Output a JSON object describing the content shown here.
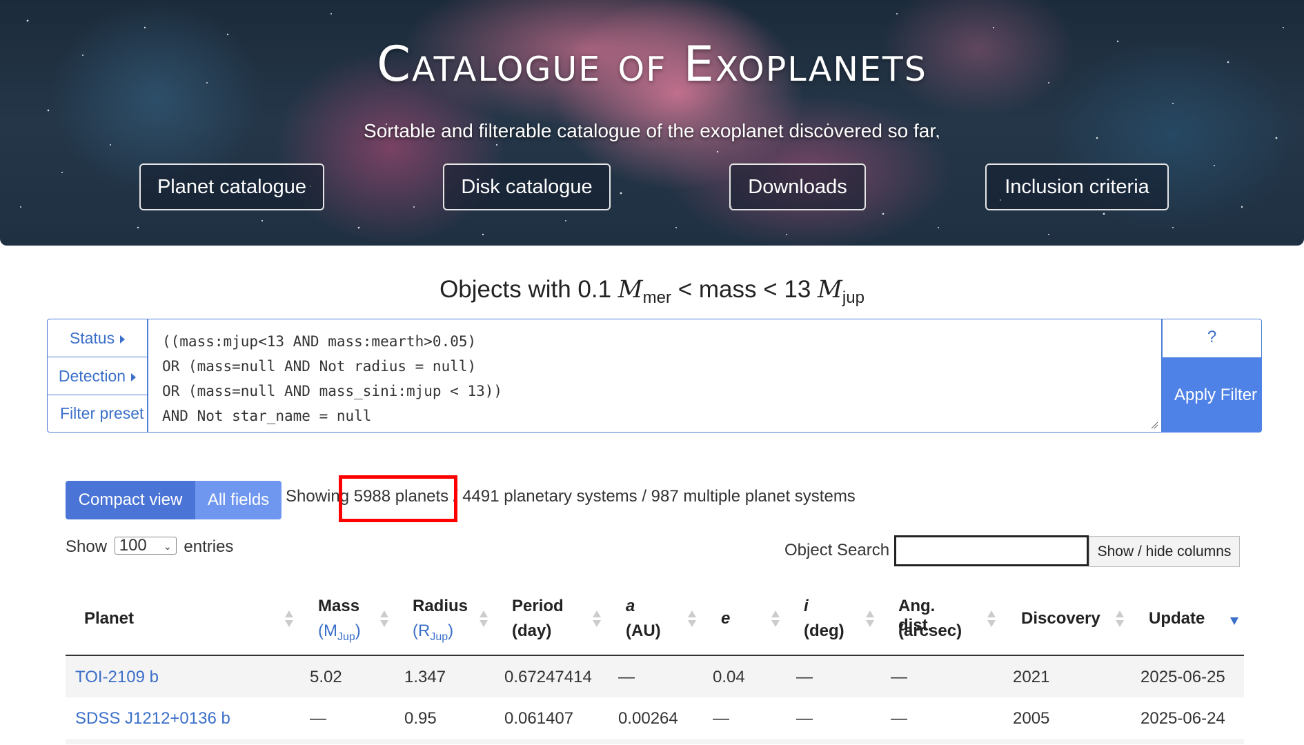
{
  "hero": {
    "title": "Catalogue of Exoplanets",
    "subtitle": "Sortable and filterable catalogue of the exoplanet discovered so far.",
    "nav": [
      "Planet catalogue",
      "Disk catalogue",
      "Downloads",
      "Inclusion criteria"
    ]
  },
  "heading": {
    "prefix": "Objects with 0.1 ",
    "m1": "M",
    "sub1": "mer",
    "middle": " < mass < 13 ",
    "m2": "M",
    "sub2": "jup"
  },
  "filter": {
    "side_buttons": [
      "Status",
      "Detection",
      "Filter preset"
    ],
    "query_lines": [
      "((mass:mjup<13 AND mass:mearth>0.05)",
      "OR (mass=null AND Not radius = null)",
      "OR (mass=null AND mass_sini:mjup < 13))",
      "AND Not star_name = null"
    ],
    "help_label": "?",
    "apply_label": "Apply Filter"
  },
  "view": {
    "compact_label": "Compact view",
    "all_label": "All fields",
    "showing_prefix": "Showing",
    "planets": "5988 planets",
    "systems": " / 4491 planetary systems / 987 multiple planet systems"
  },
  "controls": {
    "show_label": "Show",
    "entries_value": "100",
    "entries_label": "entries",
    "search_label": "Object Search",
    "search_value": "",
    "columns_button": "Show / hide columns"
  },
  "table": {
    "headers": [
      {
        "l1": "Planet"
      },
      {
        "l1": "Mass",
        "unit": "M",
        "unit_sub": "Jup"
      },
      {
        "l1": "Radius",
        "unit": "R",
        "unit_sub": "Jup"
      },
      {
        "l1": "Period",
        "l2": "(day)"
      },
      {
        "l1": "a",
        "l2": "(AU)"
      },
      {
        "l1": "e"
      },
      {
        "l1": "i",
        "l2": "(deg)"
      },
      {
        "l1": "Ang. dist.",
        "l2": "(arcsec)"
      },
      {
        "l1": "Discovery"
      },
      {
        "l1": "Update"
      }
    ],
    "rows": [
      [
        "TOI-2109 b",
        "5.02",
        "1.347",
        "0.67247414",
        "—",
        "0.04",
        "—",
        "—",
        "2021",
        "2025-06-25"
      ],
      [
        "SDSS J1212+0136 b",
        "—",
        "0.95",
        "0.061407",
        "0.00264",
        "—",
        "—",
        "—",
        "2005",
        "2025-06-24"
      ]
    ]
  },
  "colors": {
    "accent": "#4f82e6",
    "link": "#3b6fc9",
    "highlight": "#ff0000"
  }
}
